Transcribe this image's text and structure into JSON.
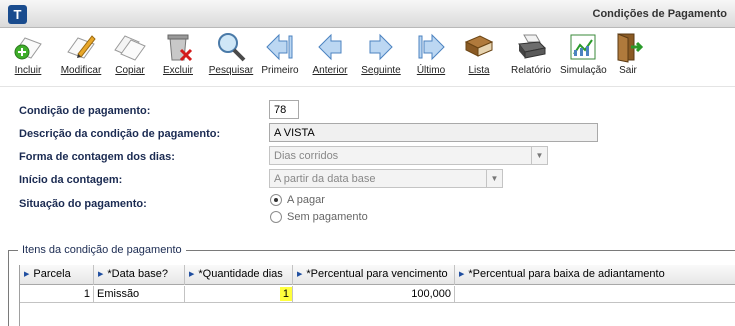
{
  "window": {
    "title": "Condições de Pagamento",
    "logo_letter": "T"
  },
  "toolbar": {
    "buttons": [
      {
        "label": "Incluir"
      },
      {
        "label": "Modificar"
      },
      {
        "label": "Copiar"
      },
      {
        "label": "Excluir"
      },
      {
        "label": "Pesquisar"
      },
      {
        "label": "Primeiro"
      },
      {
        "label": "Anterior"
      },
      {
        "label": "Seguinte"
      },
      {
        "label": "Último"
      },
      {
        "label": "Lista"
      },
      {
        "label": "Relatório"
      },
      {
        "label": "Simulação"
      },
      {
        "label": "Sair"
      }
    ]
  },
  "form": {
    "codigo_label": "Condição de pagamento:",
    "codigo_value": "78",
    "descricao_label": "Descrição da condição de pagamento:",
    "descricao_value": "A VISTA",
    "forma_label": "Forma de contagem dos dias:",
    "forma_value": "Dias corridos",
    "inicio_label": "Início da contagem:",
    "inicio_value": "A partir da data base",
    "situacao_label": "Situação do pagamento:",
    "situacao_options": [
      "A pagar",
      "Sem pagamento"
    ],
    "situacao_selected": "A pagar"
  },
  "itens": {
    "group_title": "Itens da condição de pagamento",
    "columns": [
      "Parcela",
      "*Data base?",
      "*Quantidade dias",
      "*Percentual para vencimento",
      "*Percentual para baixa de adiantamento"
    ],
    "rows": [
      {
        "parcela": "1",
        "data_base": "Emissão",
        "quantidade_dias": "1",
        "percentual_vencimento": "100,000",
        "percentual_baixa": ""
      }
    ]
  },
  "colors": {
    "label_text": "#1b2b52",
    "highlight_cell": "#ffff3c",
    "header_arrow": "#1f4ea0"
  }
}
